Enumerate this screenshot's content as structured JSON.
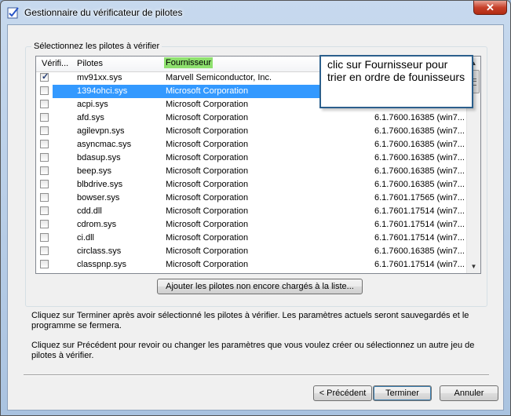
{
  "window": {
    "title": "Gestionnaire du vérificateur de pilotes",
    "close_label": "✕"
  },
  "group": {
    "label": "Sélectionnez les pilotes à vérifier"
  },
  "list": {
    "columns": {
      "verify": "Vérifi...",
      "driver": "Pilotes",
      "provider": "Fournisseur"
    },
    "rows": [
      {
        "checked": true,
        "driver": "mv91xx.sys",
        "provider": "Marvell Semiconductor, Inc.",
        "version": ""
      },
      {
        "checked": false,
        "driver": "1394ohci.sys",
        "provider": "Microsoft Corporation",
        "version": "",
        "selected": true
      },
      {
        "checked": false,
        "driver": "acpi.sys",
        "provider": "Microsoft Corporation",
        "version": ""
      },
      {
        "checked": false,
        "driver": "afd.sys",
        "provider": "Microsoft Corporation",
        "version": "6.1.7600.16385 (win7..."
      },
      {
        "checked": false,
        "driver": "agilevpn.sys",
        "provider": "Microsoft Corporation",
        "version": "6.1.7600.16385 (win7..."
      },
      {
        "checked": false,
        "driver": "asyncmac.sys",
        "provider": "Microsoft Corporation",
        "version": "6.1.7600.16385 (win7..."
      },
      {
        "checked": false,
        "driver": "bdasup.sys",
        "provider": "Microsoft Corporation",
        "version": "6.1.7600.16385 (win7..."
      },
      {
        "checked": false,
        "driver": "beep.sys",
        "provider": "Microsoft Corporation",
        "version": "6.1.7600.16385 (win7..."
      },
      {
        "checked": false,
        "driver": "blbdrive.sys",
        "provider": "Microsoft Corporation",
        "version": "6.1.7600.16385 (win7..."
      },
      {
        "checked": false,
        "driver": "bowser.sys",
        "provider": "Microsoft Corporation",
        "version": "6.1.7601.17565 (win7..."
      },
      {
        "checked": false,
        "driver": "cdd.dll",
        "provider": "Microsoft Corporation",
        "version": "6.1.7601.17514 (win7..."
      },
      {
        "checked": false,
        "driver": "cdrom.sys",
        "provider": "Microsoft Corporation",
        "version": "6.1.7601.17514 (win7..."
      },
      {
        "checked": false,
        "driver": "ci.dll",
        "provider": "Microsoft Corporation",
        "version": "6.1.7601.17514 (win7..."
      },
      {
        "checked": false,
        "driver": "circlass.sys",
        "provider": "Microsoft Corporation",
        "version": "6.1.7600.16385 (win7..."
      },
      {
        "checked": false,
        "driver": "classpnp.sys",
        "provider": "Microsoft Corporation",
        "version": "6.1.7601.17514 (win7..."
      },
      {
        "checked": false,
        "driver": "",
        "provider": "",
        "version": ""
      }
    ]
  },
  "callout": {
    "text": "clic sur Fournisseur pour trier en ordre de founisseurs"
  },
  "buttons": {
    "add_drivers": "Ajouter les pilotes non encore chargés à la liste...",
    "back": "< Précédent",
    "finish": "Terminer",
    "cancel": "Annuler"
  },
  "info": {
    "finish_text": "Cliquez sur Terminer après avoir sélectionné les pilotes à vérifier. Les paramètres actuels seront sauvegardés et le programme se fermera.",
    "back_text": "Cliquez sur Précédent pour revoir ou changer les paramètres que vous voulez créer ou sélectionnez un autre jeu de pilotes à vérifier."
  },
  "colors": {
    "selection": "#3399ff",
    "highlight_header": "#8ee06e",
    "callout_border": "#2b5f8c"
  }
}
